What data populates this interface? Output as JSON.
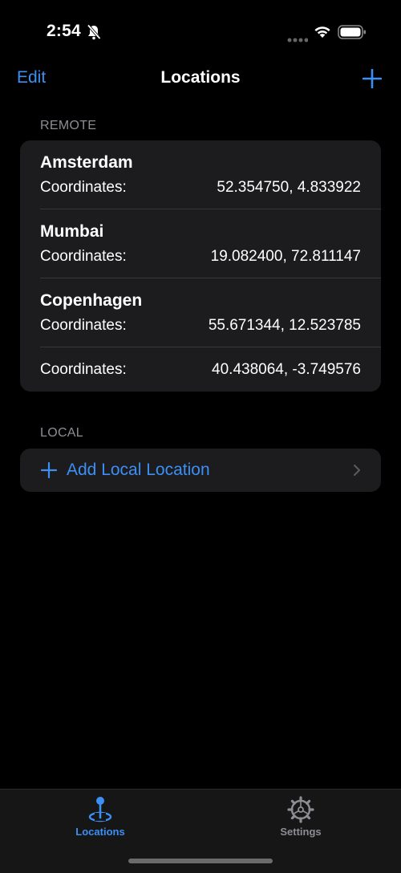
{
  "status": {
    "time": "2:54"
  },
  "nav": {
    "edit_label": "Edit",
    "title": "Locations"
  },
  "remote": {
    "header": "REMOTE",
    "items": [
      {
        "name": "Amsterdam",
        "label": "Coordinates:",
        "value": "52.354750, 4.833922"
      },
      {
        "name": "Mumbai",
        "label": "Coordinates:",
        "value": "19.082400, 72.811147"
      },
      {
        "name": "Copenhagen",
        "label": "Coordinates:",
        "value": "55.671344, 12.523785"
      },
      {
        "name": "",
        "label": "Coordinates:",
        "value": "40.438064, -3.749576"
      }
    ]
  },
  "local": {
    "header": "LOCAL",
    "add_label": "Add Local Location"
  },
  "tabs": [
    {
      "label": "Locations",
      "icon": "map-pin-icon",
      "active": true
    },
    {
      "label": "Settings",
      "icon": "gear-icon",
      "active": false
    }
  ],
  "colors": {
    "accent": "#3b8ff5",
    "background": "#000000",
    "card": "#1c1c1e",
    "secondary_text": "#8d8d93"
  }
}
